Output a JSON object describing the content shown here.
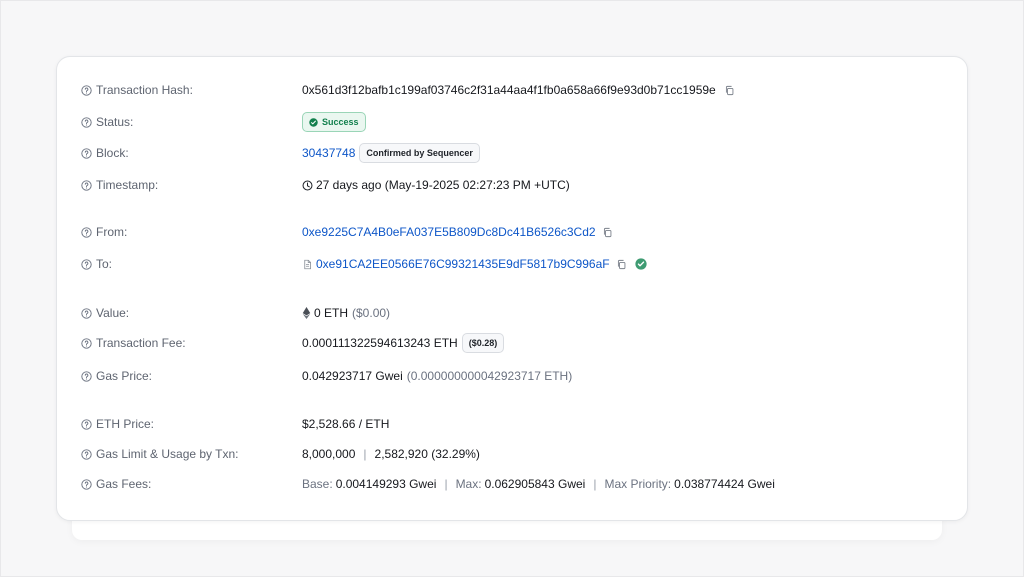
{
  "fields": {
    "transaction_hash": {
      "label": "Transaction Hash:",
      "value": "0x561d3f12bafb1c199af03746c2f31a44aa4f1fb0a658a66f9e93d0b71cc1959e"
    },
    "status": {
      "label": "Status:",
      "value": "Success"
    },
    "block": {
      "label": "Block:",
      "value": "30437748",
      "badge": "Confirmed by Sequencer"
    },
    "timestamp": {
      "label": "Timestamp:",
      "value": "27 days ago (May-19-2025 02:27:23 PM +UTC)"
    },
    "from": {
      "label": "From:",
      "value": "0xe9225C7A4B0eFA037E5B809Dc8Dc41B6526c3Cd2"
    },
    "to": {
      "label": "To:",
      "value": "0xe91CA2EE0566E76C99321435E9dF5817b9C996aF"
    },
    "value": {
      "label": "Value:",
      "amount": "0 ETH",
      "usd": "($0.00)"
    },
    "transaction_fee": {
      "label": "Transaction Fee:",
      "amount": "0.000111322594613243 ETH",
      "usd": "($0.28)"
    },
    "gas_price": {
      "label": "Gas Price:",
      "gwei": "0.042923717 Gwei",
      "eth": "(0.000000000042923717 ETH)"
    },
    "eth_price": {
      "label": "ETH Price:",
      "value": "$2,528.66 / ETH"
    },
    "gas_limit": {
      "label": "Gas Limit & Usage by Txn:",
      "limit": "8,000,000",
      "separator": "|",
      "usage": "2,582,920 (32.29%)"
    },
    "gas_fees": {
      "label": "Gas Fees:",
      "base_label": "Base:",
      "base_value": "0.004149293 Gwei",
      "max_label": "Max:",
      "max_value": "0.062905843 Gwei",
      "priority_label": "Max Priority:",
      "priority_value": "0.038774424 Gwei",
      "separator": "|"
    }
  },
  "colors": {
    "link": "#0d56c8",
    "success": "#12804d",
    "label": "#5e6470"
  },
  "icons": {
    "help": "question-circle-icon",
    "copy": "copy-icon",
    "clock": "clock-icon",
    "contract": "file-icon",
    "verified": "check-circle-icon",
    "eth": "ethereum-icon"
  }
}
